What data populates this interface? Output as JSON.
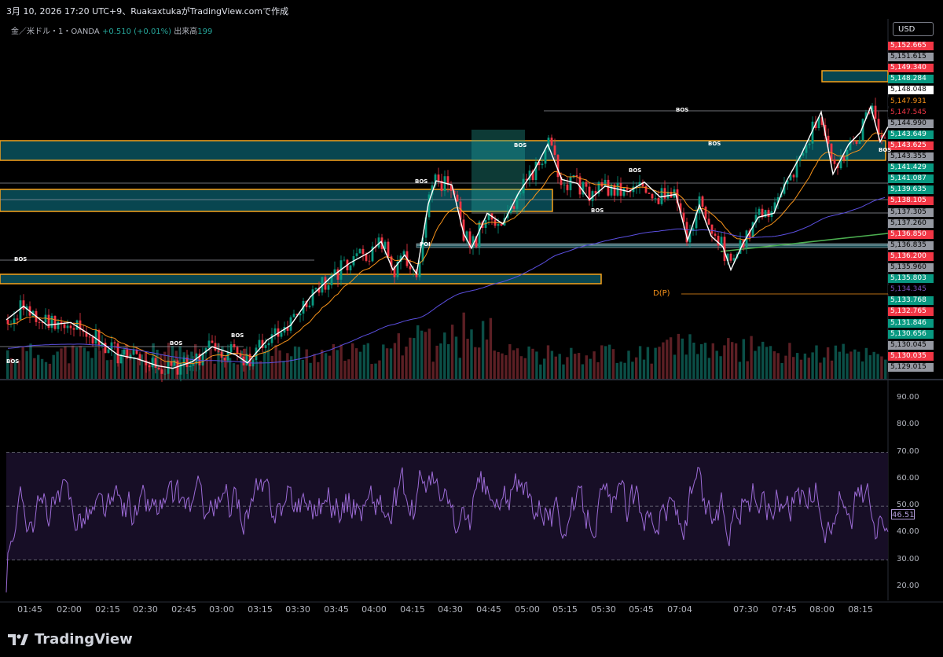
{
  "header": {
    "text": "3月 10, 2026 17:20 UTC+9、RuakaxtukaがTradingView.comで作成"
  },
  "symbol": {
    "name": "金／米ドル・1・OANDA",
    "change": "+0.510 (+0.01%)",
    "volume_label": "出来高",
    "volume_value": "199"
  },
  "currency": "USD",
  "price_scale": {
    "labels": [
      {
        "value": "5,152.665",
        "color": "#f23645",
        "text_color": "#ffffff"
      },
      {
        "value": "5,151.615",
        "color": "#9598a1",
        "text_color": "#000000"
      },
      {
        "value": "5,149.340",
        "color": "#f23645",
        "text_color": "#ffffff"
      },
      {
        "value": "5,148.284",
        "color": "#089981",
        "text_color": "#ffffff"
      },
      {
        "value": "5,148.048",
        "color": "#ffffff",
        "text_color": "#000000"
      },
      {
        "value": "5,147.931",
        "color": "#000000",
        "text_color": "#f7931a"
      },
      {
        "value": "5,147.545",
        "color": "#000000",
        "text_color": "#f23645"
      },
      {
        "value": "5,144.990",
        "color": "#9598a1",
        "text_color": "#000000"
      },
      {
        "value": "5,143.649",
        "color": "#089981",
        "text_color": "#ffffff"
      },
      {
        "value": "5,143.625",
        "color": "#f23645",
        "text_color": "#ffffff"
      },
      {
        "value": "5,143.355",
        "color": "#9598a1",
        "text_color": "#000000"
      },
      {
        "value": "5,141.429",
        "color": "#089981",
        "text_color": "#ffffff"
      },
      {
        "value": "5,141.087",
        "color": "#089981",
        "text_color": "#ffffff"
      },
      {
        "value": "5,139.635",
        "color": "#089981",
        "text_color": "#ffffff"
      },
      {
        "value": "5,138.105",
        "color": "#f23645",
        "text_color": "#ffffff"
      },
      {
        "value": "5,137.305",
        "color": "#9598a1",
        "text_color": "#000000"
      },
      {
        "value": "5,137.260",
        "color": "#9598a1",
        "text_color": "#000000"
      },
      {
        "value": "5,136.850",
        "color": "#f23645",
        "text_color": "#ffffff"
      },
      {
        "value": "5,136.835",
        "color": "#9598a1",
        "text_color": "#000000"
      },
      {
        "value": "5,136.200",
        "color": "#f23645",
        "text_color": "#ffffff"
      },
      {
        "value": "5,135.960",
        "color": "#9598a1",
        "text_color": "#000000"
      },
      {
        "value": "5,135.803",
        "color": "#089981",
        "text_color": "#ffffff"
      },
      {
        "value": "5,134.345",
        "color": "#000000",
        "text_color": "#7e57c2"
      },
      {
        "value": "5,133.768",
        "color": "#089981",
        "text_color": "#ffffff"
      },
      {
        "value": "5,132.765",
        "color": "#f23645",
        "text_color": "#ffffff"
      },
      {
        "value": "5,131.846",
        "color": "#089981",
        "text_color": "#ffffff"
      },
      {
        "value": "5,130.656",
        "color": "#089981",
        "text_color": "#ffffff"
      },
      {
        "value": "5,130.045",
        "color": "#9598a1",
        "text_color": "#000000"
      },
      {
        "value": "5,130.035",
        "color": "#f23645",
        "text_color": "#ffffff"
      },
      {
        "value": "5,129.015",
        "color": "#9598a1",
        "text_color": "#000000"
      }
    ]
  },
  "rsi": {
    "axis_labels": [
      "90.00",
      "80.00",
      "70.00",
      "60.00",
      "50.00",
      "40.00",
      "30.00",
      "20.00"
    ],
    "current_value": "46.51",
    "upper_band": 70,
    "lower_band": 30,
    "mid": 50
  },
  "time_axis": {
    "labels": [
      "01:45",
      "02:00",
      "02:15",
      "02:30",
      "02:45",
      "03:00",
      "03:15",
      "03:30",
      "03:45",
      "04:00",
      "04:15",
      "04:30",
      "04:45",
      "05:00",
      "05:15",
      "05:30",
      "05:45",
      "07:04",
      "07:30",
      "07:45",
      "08:00",
      "08:15"
    ]
  },
  "annotations": {
    "bos": "BOS",
    "poi": "POI",
    "dp": "D(P)"
  },
  "colors": {
    "up": "#089981",
    "down": "#f23645",
    "zone_fill": "#0b5e6b",
    "zone_border": "#f7a21b",
    "ema": "#f7931a",
    "ma_slow": "#5b4fe0",
    "rsi_line": "#9c6bd6",
    "trendline": "#4caf50"
  },
  "chart_data": {
    "type": "candlestick",
    "symbol": "金／米ドル・1・OANDA",
    "price_range": [
      5129.0,
      5153.0
    ],
    "key_levels": [
      5152.665,
      5149.34,
      5148.048,
      5147.931,
      5147.545,
      5143.649,
      5143.355,
      5138.105,
      5136.835,
      5134.345,
      5129.015
    ],
    "rsi_range": [
      15,
      95
    ],
    "rsi_last": 46.51
  },
  "footer": {
    "brand": "TradingView"
  }
}
